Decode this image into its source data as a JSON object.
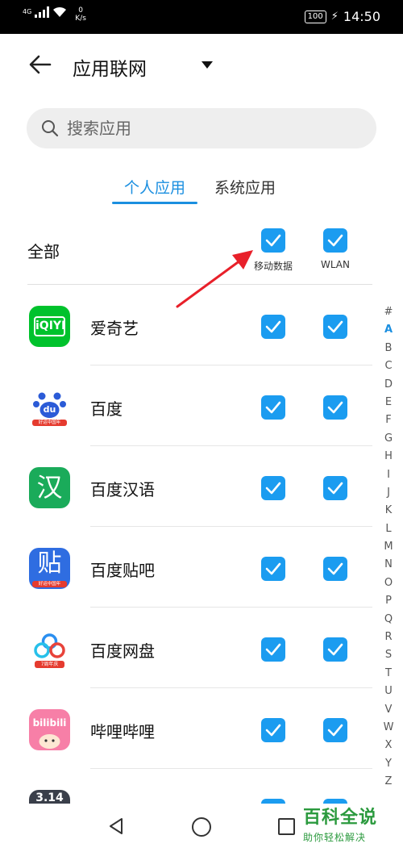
{
  "status_bar": {
    "network": "4G",
    "speed_value": "0",
    "speed_unit": "K/s",
    "battery": "100",
    "time": "14:50"
  },
  "header": {
    "title": "应用联网"
  },
  "search": {
    "placeholder": "搜索应用"
  },
  "tabs": [
    {
      "label": "个人应用",
      "active": true
    },
    {
      "label": "系统应用",
      "active": false
    }
  ],
  "all_row": {
    "label": "全部",
    "mobile_data_label": "移动数据",
    "wlan_label": "WLAN"
  },
  "apps": [
    {
      "name": "爱奇艺",
      "mobile_data": true,
      "wlan": true,
      "icon": "iqiyi-icon",
      "icon_text": "iQIYI"
    },
    {
      "name": "百度",
      "mobile_data": true,
      "wlan": true,
      "icon": "baidu-icon",
      "icon_text": "du",
      "icon_sub": "好运中国年"
    },
    {
      "name": "百度汉语",
      "mobile_data": true,
      "wlan": true,
      "icon": "baidu-hanyu-icon",
      "icon_text": "汉"
    },
    {
      "name": "百度贴吧",
      "mobile_data": true,
      "wlan": true,
      "icon": "baidu-tieba-icon",
      "icon_text": "贴",
      "icon_sub": "好运中国年"
    },
    {
      "name": "百度网盘",
      "mobile_data": true,
      "wlan": true,
      "icon": "baidu-netdisk-icon",
      "icon_sub": "7周年庆"
    },
    {
      "name": "哔哩哔哩",
      "mobile_data": true,
      "wlan": true,
      "icon": "bilibili-icon",
      "icon_text": "bilibili"
    }
  ],
  "partial_app": {
    "icon_text": "3.14"
  },
  "alphabet_index": [
    "#",
    "A",
    "B",
    "C",
    "D",
    "E",
    "F",
    "G",
    "H",
    "I",
    "J",
    "K",
    "L",
    "M",
    "N",
    "O",
    "P",
    "Q",
    "R",
    "S",
    "T",
    "U",
    "V",
    "W",
    "X",
    "Y",
    "Z"
  ],
  "alphabet_active": "A",
  "watermark": {
    "title": "百科全说",
    "subtitle": "助你轻松解决"
  },
  "colors": {
    "accent": "#1b8fe0",
    "checkbox": "#1b9cf0",
    "arrow": "#e8202a",
    "watermark": "#2b9a3e"
  }
}
